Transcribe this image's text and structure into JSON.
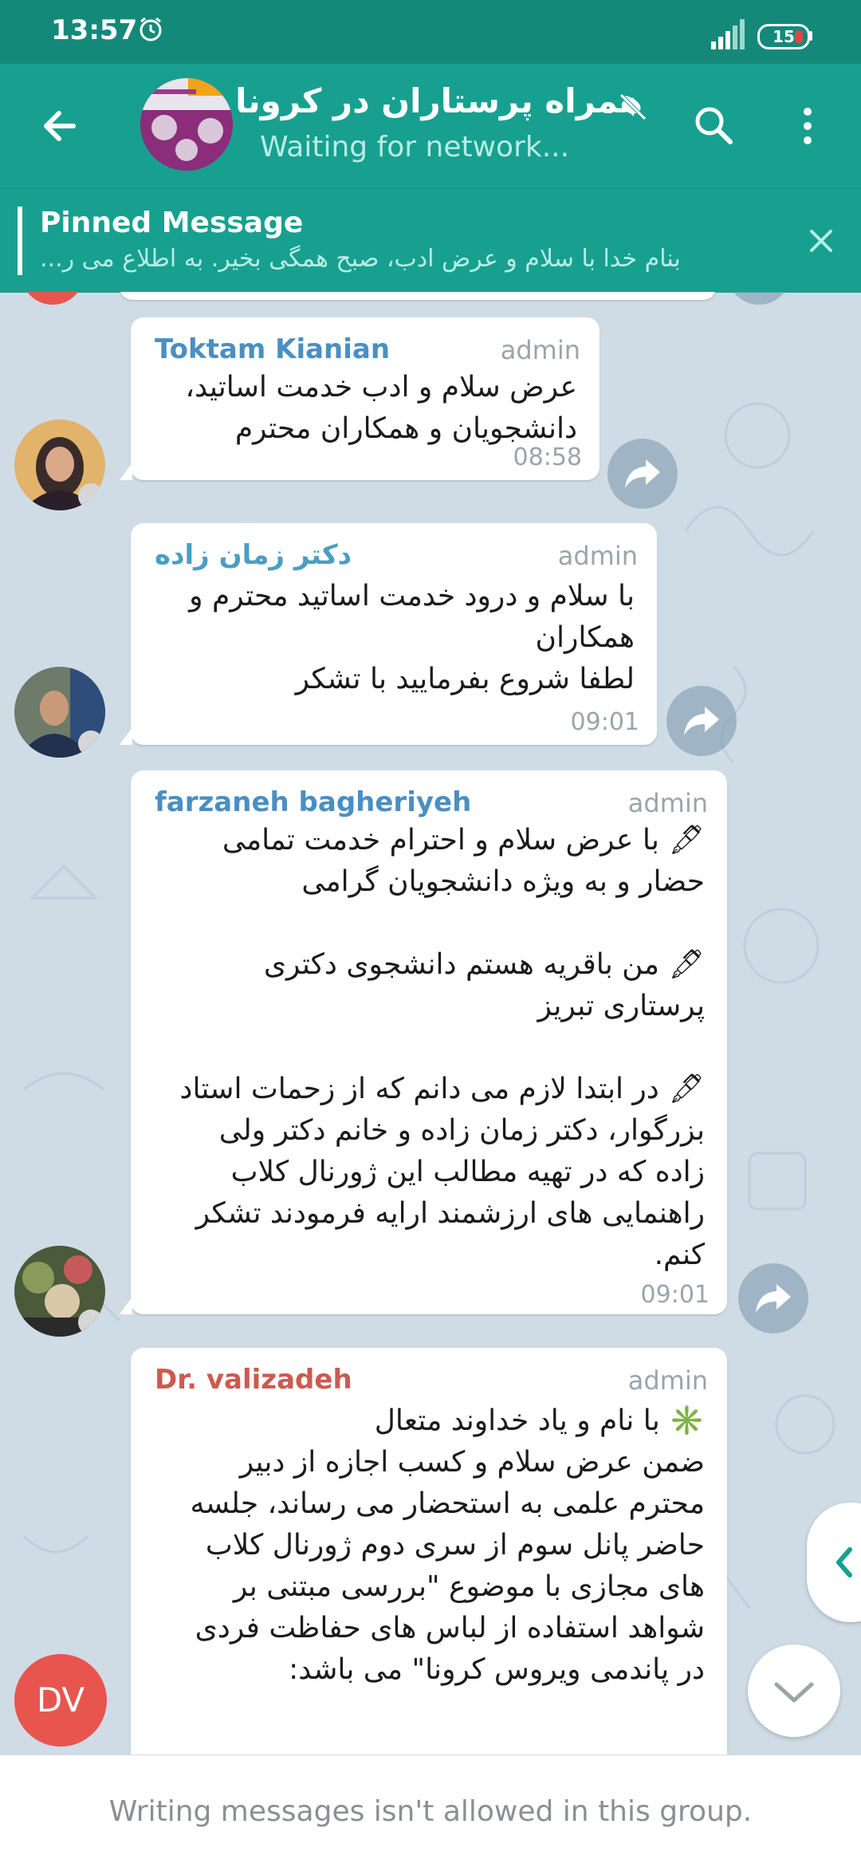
{
  "status_bar": {
    "time": "13:57",
    "battery": "15"
  },
  "header": {
    "group_title": "همراه پرستاران در کرونا",
    "subtitle": "Waiting for network..."
  },
  "pinned": {
    "title": "Pinned Message",
    "text": "بنام خدا با سلام و عرض ادب، صبح همگی بخیر. به اطلاع می ر..."
  },
  "messages": [
    {
      "sender": "Toktam Kianian",
      "sender_color": "#4a8fc2",
      "role": "admin",
      "text": "عرض سلام و ادب خدمت اساتید،\nدانشجویان و همکاران محترم",
      "time": "08:58"
    },
    {
      "sender": "دکتر زمان زاده",
      "sender_color": "#4a9fc2",
      "role": "admin",
      "text": "با سلام و درود خدمت اساتید محترم و\nهمکاران\nلطفا شروع بفرمایید با تشکر",
      "time": "09:01"
    },
    {
      "sender": "farzaneh bagheriyeh",
      "sender_color": "#4a8fc2",
      "role": "admin",
      "text": "🖋 با عرض سلام و احترام خدمت تمامی\nحضار و به ویژه دانشجویان گرامی\n\n🖋 من باقریه هستم دانشجوی دکتری\nپرستاری تبریز\n\n🖋 در ابتدا لازم می دانم که از زحمات استاد\nبزرگوار، دکتر زمان زاده و خانم دکتر ولی\nزاده که در تهیه مطالب این ژورنال کلاب\nراهنمایی های ارزشمند ارایه فرمودند تشکر\nکنم.",
      "time": "09:01"
    },
    {
      "sender": "Dr. valizadeh",
      "sender_color": "#cc5a4f",
      "role": "admin",
      "text": "✳️ با نام و یاد خداوند متعال\nضمن عرض سلام و کسب اجازه از دبیر\nمحترم علمی به استحضار می رساند، جلسه\nحاضر پانل سوم از سری دوم ژورنال کلاب\nهای مجازی با موضوع \"بررسی مبتنی بر\nشواهد استفاده از لباس های حفاظت فردی\nدر پاندمی ویروس کرونا\" می باشد:"
    }
  ],
  "dv_avatar_initials": "DV",
  "footer": {
    "notice": "Writing messages isn't allowed in this group."
  }
}
